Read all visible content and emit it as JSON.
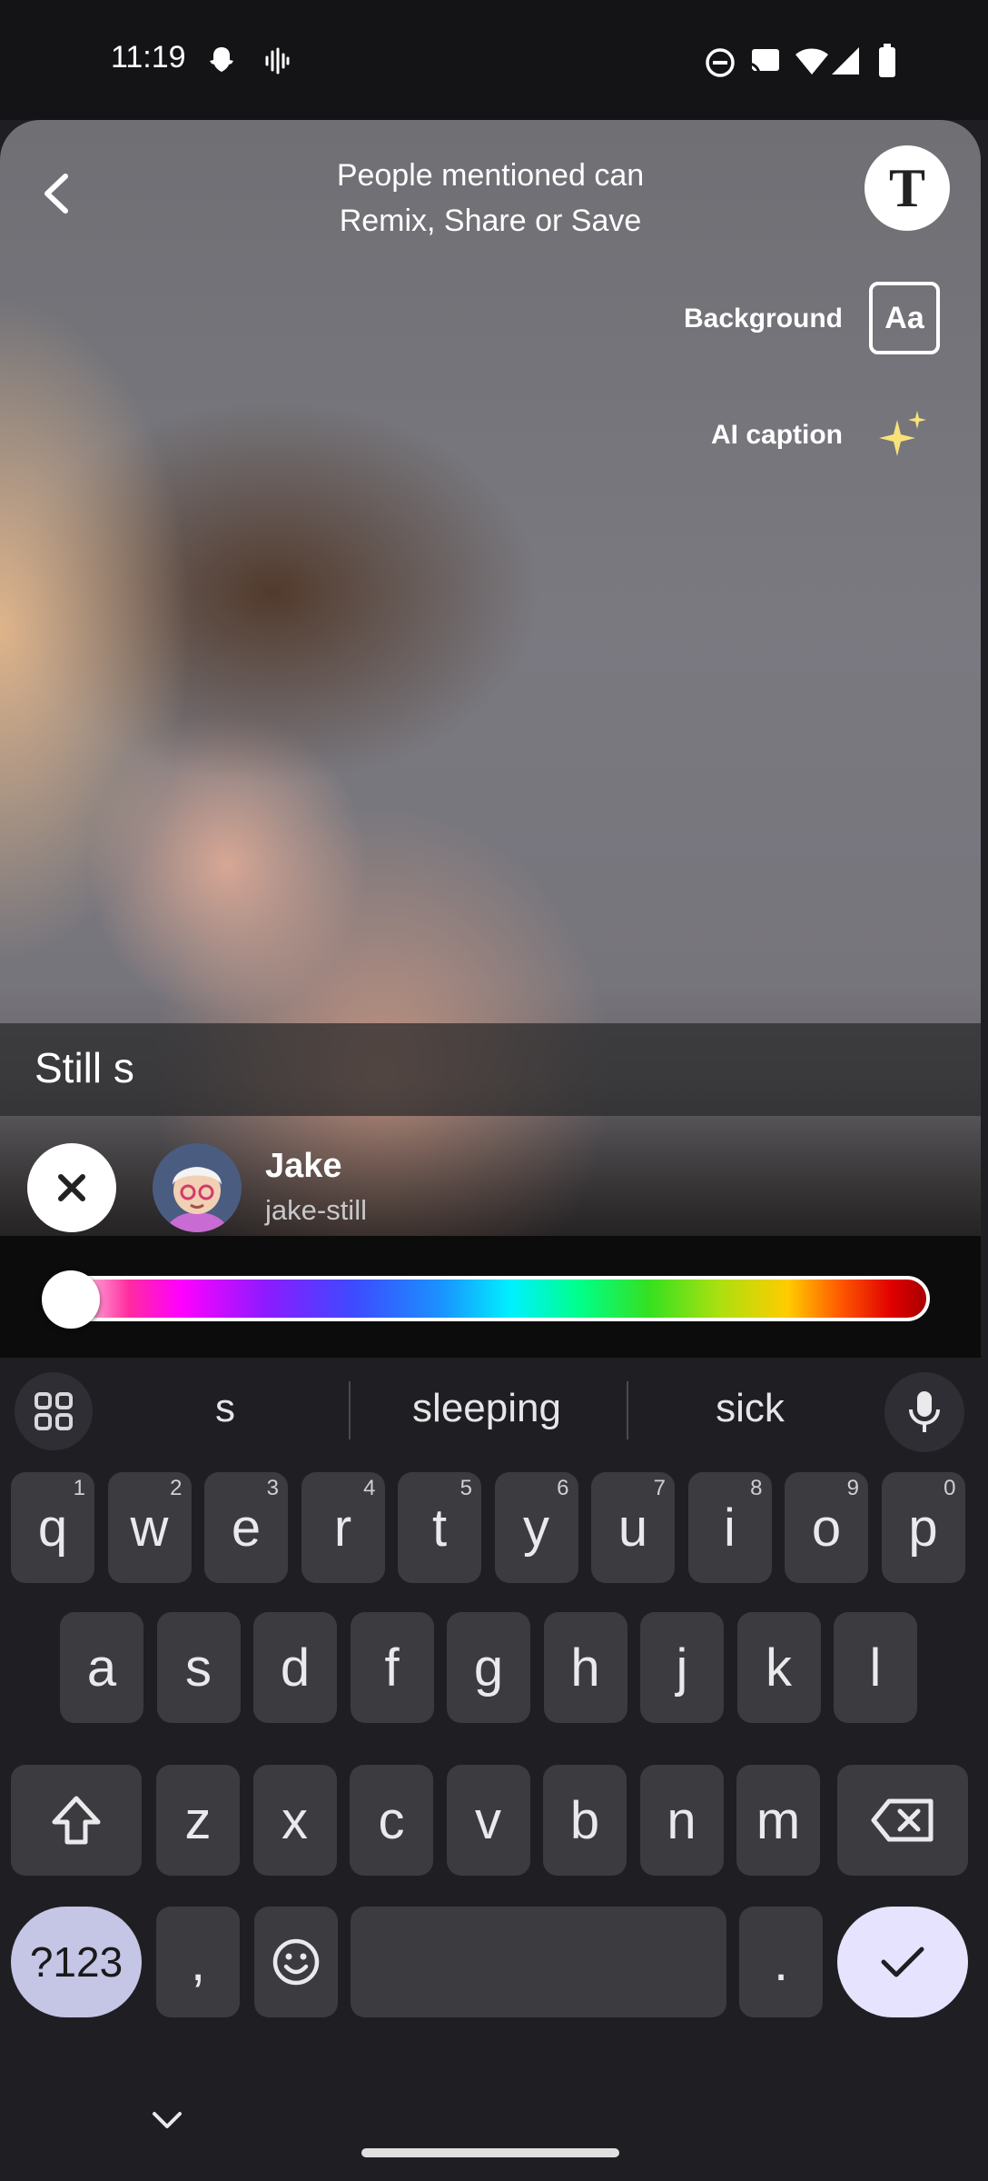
{
  "status_bar": {
    "time": "11:19"
  },
  "header": {
    "mention_note_line1": "People mentioned can",
    "mention_note_line2": "Remix, Share or Save",
    "text_tool_glyph": "T"
  },
  "side_tools": {
    "background_label": "Background",
    "background_glyph": "Aa",
    "ai_caption_label": "AI caption"
  },
  "caption": {
    "text": "Still s"
  },
  "mention": {
    "name": "Jake",
    "username": "jake-still"
  },
  "color_slider": {
    "level": 0.0
  },
  "keyboard": {
    "suggestions": [
      "s",
      "sleeping",
      "sick"
    ],
    "row1": [
      {
        "k": "q",
        "h": "1"
      },
      {
        "k": "w",
        "h": "2"
      },
      {
        "k": "e",
        "h": "3"
      },
      {
        "k": "r",
        "h": "4"
      },
      {
        "k": "t",
        "h": "5"
      },
      {
        "k": "y",
        "h": "6"
      },
      {
        "k": "u",
        "h": "7"
      },
      {
        "k": "i",
        "h": "8"
      },
      {
        "k": "o",
        "h": "9"
      },
      {
        "k": "p",
        "h": "0"
      }
    ],
    "row2": [
      "a",
      "s",
      "d",
      "f",
      "g",
      "h",
      "j",
      "k",
      "l"
    ],
    "row3": [
      "z",
      "x",
      "c",
      "v",
      "b",
      "n",
      "m"
    ],
    "symbols_label": "?123",
    "comma": ",",
    "period": "."
  }
}
